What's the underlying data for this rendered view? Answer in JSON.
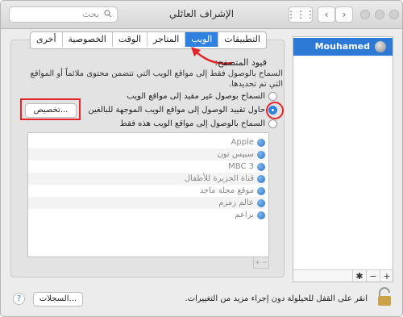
{
  "window": {
    "title": "الإشراف العائلي"
  },
  "toolbar": {
    "search_placeholder": "بحث",
    "grid_icon": "grid-icon",
    "back_icon": "chevron-left-icon",
    "forward_icon": "chevron-right-icon"
  },
  "tabs": [
    "التطبيقات",
    "الويب",
    "المتاجر",
    "الوقت",
    "الخصوصية",
    "أخرى"
  ],
  "active_tab": "الويب",
  "section": {
    "title": "قيود المتصفح:",
    "description": "السماح بالوصول فقط إلى مواقع الويب التي تتضمن محتوى ملائماً أو المواقع التي تم تحديدها."
  },
  "options": [
    {
      "label": "السماح بوصول غير مقيد إلى مواقع الويب",
      "selected": false
    },
    {
      "label": "حاول تقييد الوصول إلى مواقع الويب الموجهة للبالغين",
      "selected": true
    },
    {
      "label": "السماح بالوصول إلى مواقع الويب هذه فقط",
      "selected": false
    }
  ],
  "customize_button": "تخصيص...",
  "sites": [
    "Apple",
    "سبيس تون",
    "MBC 3",
    "قناة الجزيرة للأطفال",
    "موقع مجلة ماجد",
    "عالم زمزم",
    "براعم"
  ],
  "users": [
    {
      "name": "Mouhamed"
    }
  ],
  "footer": {
    "lock_text": "انقر على القفل للحيلولة دون إجراء مزيد من التغييرات.",
    "logs_button": "السجلات...",
    "help": "?"
  },
  "colors": {
    "accent": "#2f80df",
    "highlight": "#e4262b"
  }
}
